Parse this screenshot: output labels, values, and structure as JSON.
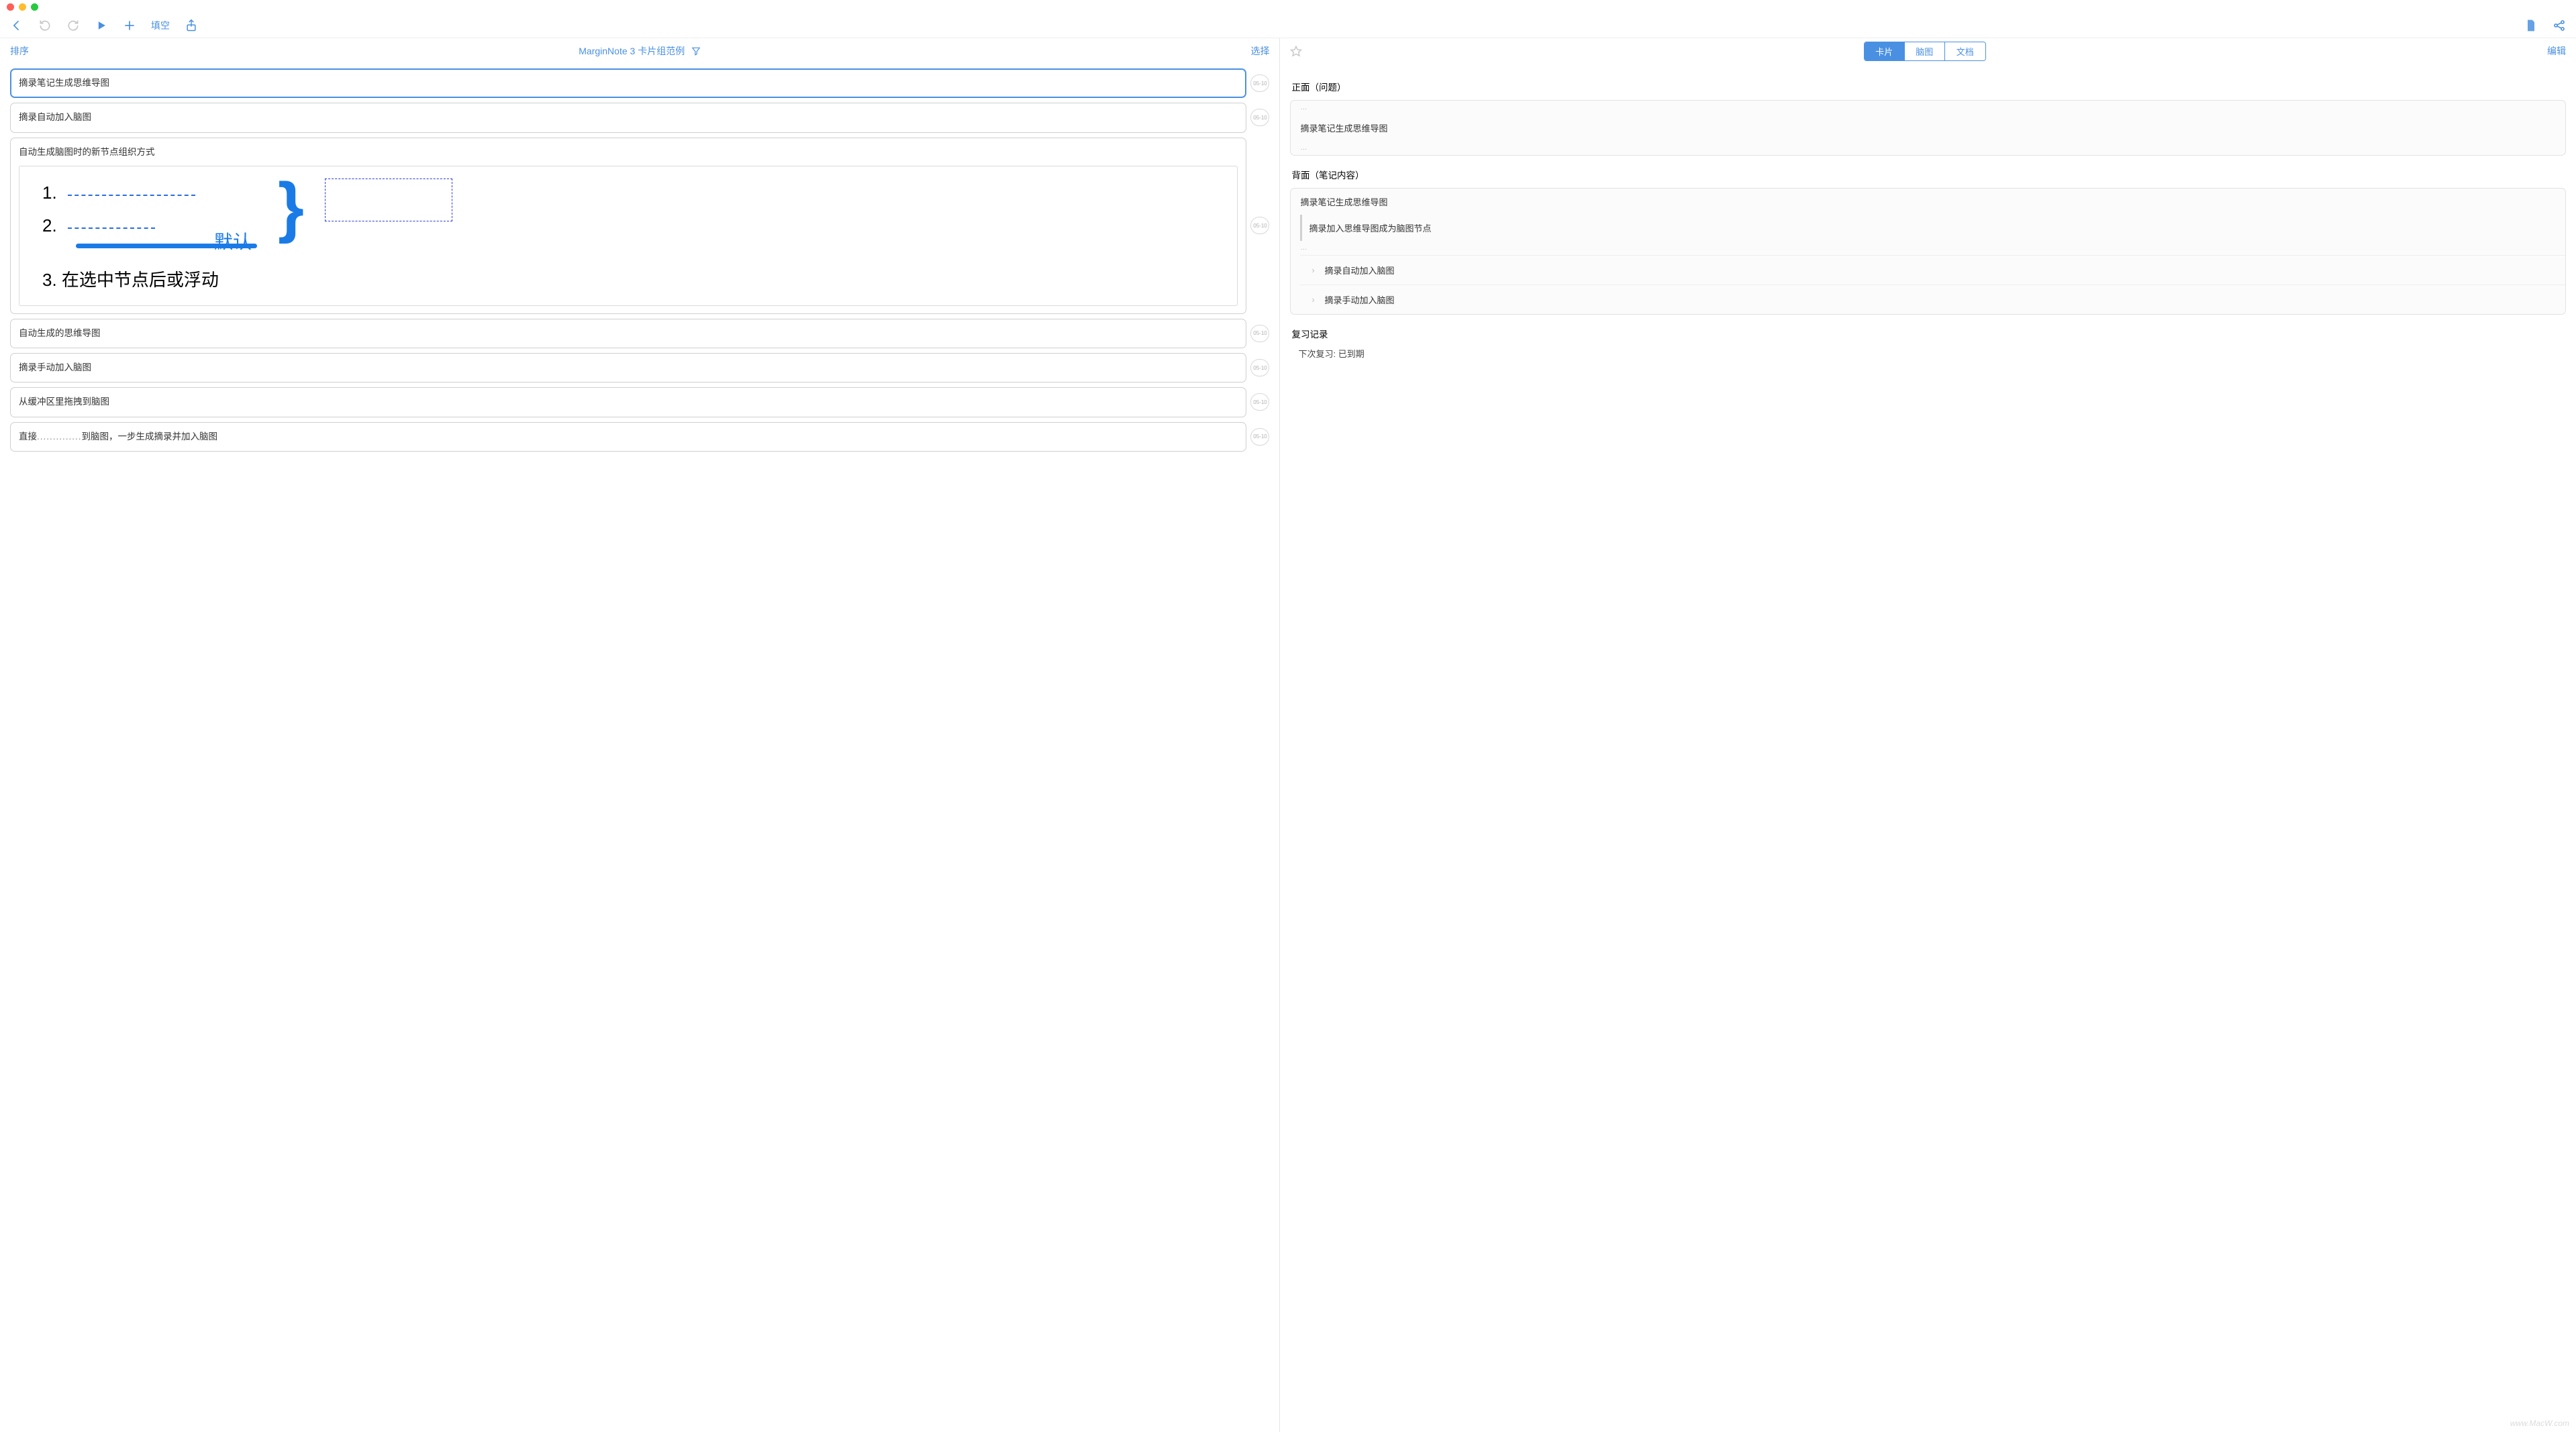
{
  "traffic": {
    "colors": [
      "red",
      "yellow",
      "green"
    ]
  },
  "toolbar": {
    "fill_blank_label": "填空"
  },
  "list_header": {
    "sort_label": "排序",
    "title": "MarginNote 3 卡片组范例",
    "select_label": "选择"
  },
  "cards": [
    {
      "title": "摘录笔记生成思维导图",
      "date": "05-10",
      "selected": true
    },
    {
      "title": "摘录自动加入脑图",
      "date": "05-10"
    },
    {
      "title": "自动生成脑图时的新节点组织方式",
      "date": "05-10",
      "has_image": true,
      "image": {
        "n1": "1.",
        "n2": "2.",
        "n3_text": "3.  在选中节点后或浮动",
        "big_label": "默认"
      }
    },
    {
      "title": "自动生成的思维导图",
      "date": "05-10"
    },
    {
      "title": "摘录手动加入脑图",
      "date": "05-10"
    },
    {
      "title": "从缓冲区里拖拽到脑图",
      "date": "05-10"
    },
    {
      "title_pre": "直接",
      "title_post": "到脑图，一步生成摘录并加入脑图",
      "date": "05-10",
      "has_blank": true
    }
  ],
  "right": {
    "edit_label": "编辑",
    "tabs": [
      "卡片",
      "脑图",
      "文档"
    ],
    "active_tab": 0,
    "front": {
      "label": "正面（问题）",
      "dots1": "…",
      "text": "摘录笔记生成思维导图",
      "dots2": "…"
    },
    "back": {
      "label": "背面（笔记内容）",
      "line1": "摘录笔记生成思维导图",
      "line2": "摘录加入思维导图成为脑图节点",
      "dots": "…",
      "sub1": "摘录自动加入脑图",
      "sub2": "摘录手动加入脑图"
    },
    "review": {
      "label": "复习记录",
      "status": "下次复习: 已到期"
    }
  },
  "watermark": "www.MacW.com"
}
